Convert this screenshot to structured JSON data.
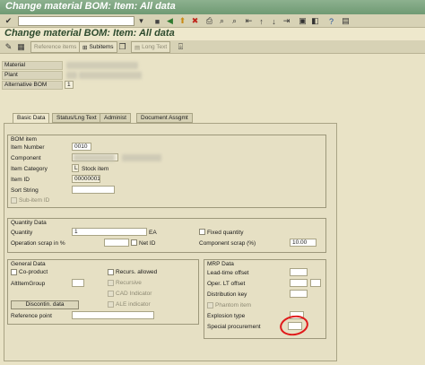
{
  "window": {
    "title": "Change material BOM: Item: All data"
  },
  "page": {
    "title": "Change material BOM: Item: All data"
  },
  "app_toolbar": {
    "reference_items": "Reference items",
    "subitems": "Subitems",
    "long_text": "Long Text"
  },
  "header": {
    "material_label": "Material",
    "plant_label": "Plant",
    "alt_bom_label": "Alternative BOM",
    "alt_bom_value": "1"
  },
  "tabs": [
    "Basic Data",
    "Status/Lng Text",
    "Administ",
    "Document Assgmt"
  ],
  "bom_item": {
    "title": "BOM item",
    "item_number_label": "Item Number",
    "item_number_value": "0010",
    "component_label": "Component",
    "item_category_label": "Item Category",
    "item_category_value": "L",
    "item_category_text": "Stock item",
    "item_id_label": "Item ID",
    "item_id_value": "00000001",
    "sort_string_label": "Sort String",
    "sub_item_id_label": "Sub-item ID"
  },
  "quantity_data": {
    "title": "Quantity Data",
    "quantity_label": "Quantity",
    "quantity_value": "1",
    "unit_value": "EA",
    "fixed_quantity_label": "Fixed quantity",
    "operation_scrap_label": "Operation scrap in %",
    "net_id_label": "Net ID",
    "component_scrap_label": "Component scrap (%)",
    "component_scrap_value": "10.00"
  },
  "general_data": {
    "title": "General Data",
    "co_product_label": "Co-product",
    "alt_item_group_label": "AltItemGroup",
    "discontin_button": "Discontin. data",
    "reference_point_label": "Reference point",
    "recurs_allowed_label": "Recurs. allowed",
    "recursive_label": "Recursive",
    "cad_indicator_label": "CAD Indicator",
    "ale_indicator_label": "ALE indicator"
  },
  "mrp_data": {
    "title": "MRP Data",
    "lead_time_offset_label": "Lead-time offset",
    "oper_lt_offset_label": "Oper. LT offset",
    "distribution_key_label": "Distribution key",
    "phantom_item_label": "Phantom item",
    "explosion_type_label": "Explosion type",
    "special_procurement_label": "Special procurement"
  }
}
